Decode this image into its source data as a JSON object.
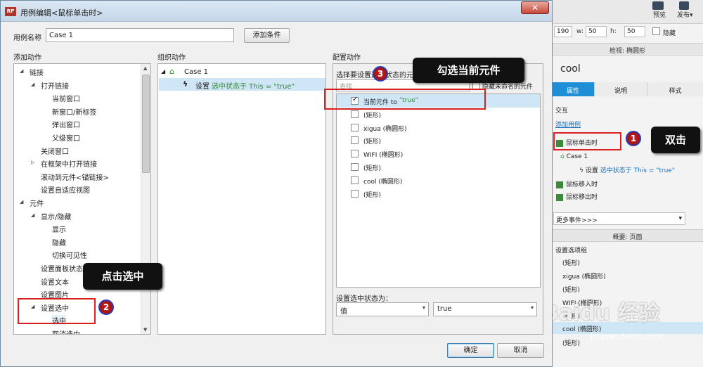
{
  "dialog": {
    "title": "用例编辑<鼠标单击时>",
    "app_icon": "RP",
    "close": "✕",
    "case_name_label": "用例名称",
    "case_name_value": "Case 1",
    "add_condition": "添加条件",
    "ok": "确定",
    "cancel": "取消"
  },
  "add_actions": {
    "header": "添加动作",
    "items": [
      {
        "label": "链接",
        "indent": 1,
        "arrow": "◢"
      },
      {
        "label": "打开链接",
        "indent": 2,
        "arrow": "◢"
      },
      {
        "label": "当前窗口",
        "indent": 3
      },
      {
        "label": "新窗口/新标签",
        "indent": 3
      },
      {
        "label": "弹出窗口",
        "indent": 3
      },
      {
        "label": "父级窗口",
        "indent": 3
      },
      {
        "label": "关闭窗口",
        "indent": 2
      },
      {
        "label": "在框架中打开链接",
        "indent": 2,
        "arrow": "▷"
      },
      {
        "label": "滚动到元件<锚链接>",
        "indent": 2
      },
      {
        "label": "设置自适应视图",
        "indent": 2
      },
      {
        "label": "元件",
        "indent": 1,
        "arrow": "◢"
      },
      {
        "label": "显示/隐藏",
        "indent": 2,
        "arrow": "◢"
      },
      {
        "label": "显示",
        "indent": 3
      },
      {
        "label": "隐藏",
        "indent": 3
      },
      {
        "label": "切换可见性",
        "indent": 3
      },
      {
        "label": "设置面板状态",
        "indent": 2
      },
      {
        "label": "设置文本",
        "indent": 2
      },
      {
        "label": "设置图片",
        "indent": 2
      },
      {
        "label": "设置选中",
        "indent": 2,
        "arrow": "◢"
      },
      {
        "label": "选中",
        "indent": 3
      },
      {
        "label": "取消选中",
        "indent": 3
      }
    ]
  },
  "organize": {
    "header": "组织动作",
    "case_label": "Case 1",
    "action_prefix": "设置",
    "action_text": "选中状态于 This = \"true\""
  },
  "configure": {
    "header": "配置动作",
    "select_label": "选择要设置选中状态的元件",
    "hide_unnamed": "隐藏未命名的元件",
    "search_placeholder": "查找",
    "widgets": [
      {
        "label": "当前元件 to ",
        "value": "\"true\"",
        "checked": true
      },
      {
        "label": "(矩形)",
        "value": "",
        "checked": false
      },
      {
        "label": "xigua (椭圆形)",
        "value": "",
        "checked": false
      },
      {
        "label": "(矩形)",
        "value": "",
        "checked": false
      },
      {
        "label": "WIFI (椭圆形)",
        "value": "",
        "checked": false
      },
      {
        "label": "(矩形)",
        "value": "",
        "checked": false
      },
      {
        "label": "cool (椭圆形)",
        "value": "",
        "checked": false
      },
      {
        "label": "(矩形)",
        "value": "",
        "checked": false
      }
    ],
    "state_label": "设置选中状态为：",
    "state_mode": "值",
    "state_value": "true"
  },
  "annotations": {
    "step1_num": "1",
    "step1_text": "双击",
    "step2_num": "2",
    "step2_text": "点击选中",
    "step3_num": "3",
    "step3_text": "勾选当前元件"
  },
  "background": {
    "preview": "预览",
    "publish": "发布▾",
    "y_value": "190",
    "w_label": "w:",
    "w_value": "50",
    "h_label": "h:",
    "h_value": "50",
    "hidden_label": "隐藏",
    "inspector_title": "检视: 椭圆形",
    "widget_name": "cool",
    "tabs": [
      "属性",
      "说明",
      "样式"
    ],
    "interaction_label": "交互",
    "add_case": "添加用例",
    "events": [
      "鼠标单击时",
      "Case 1",
      "鼠标移入时",
      "鼠标移出时"
    ],
    "event_action_prefix": "设置",
    "event_action_text": "选中状态于 This = \"true\"",
    "more_events": "更多事件>>>",
    "outline_title": "概要: 页面",
    "outline_items": [
      "设置选项组",
      "(矩形)",
      "xigua (椭圆形)",
      "(矩形)",
      "WIFI (椭圆形)",
      "(矩形)",
      "cool (椭圆形)",
      "(矩形)"
    ]
  },
  "watermark": "Baidu 经验",
  "watermark_url": "jingyan.baidu.com",
  "colors": {
    "accent_blue": "#cfe6f6",
    "annotation_red": "#d9201e",
    "action_green": "#2e8b2e",
    "tab_active": "#1e8fd6"
  }
}
